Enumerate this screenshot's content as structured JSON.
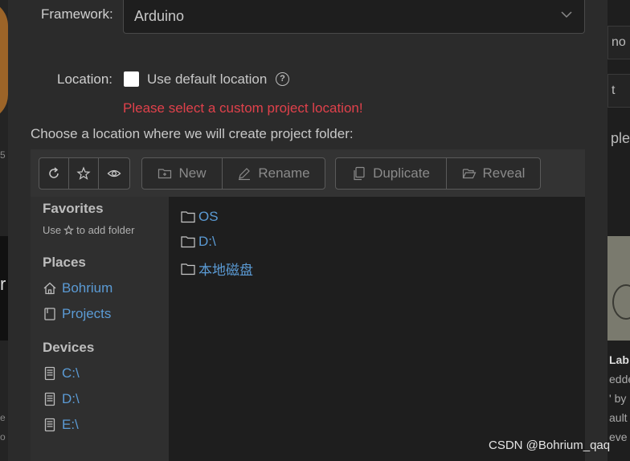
{
  "background": {
    "left_fragments": [
      "5",
      "r",
      "e",
      "o"
    ],
    "right_fragments": {
      "box1": "no",
      "box2": "t",
      "box3": "ple",
      "card_title": "Lab",
      "card_lines": [
        "edde",
        "' by",
        "ault",
        "eve"
      ]
    }
  },
  "dialog": {
    "framework": {
      "label": "Framework:",
      "value": "Arduino"
    },
    "location": {
      "label": "Location:",
      "checkbox_label": "Use default location",
      "help": "?",
      "error": "Please select a custom project location!"
    },
    "choose_text": "Choose a location where we will create project folder:"
  },
  "toolbar": {
    "new_label": "New",
    "rename_label": "Rename",
    "duplicate_label": "Duplicate",
    "reveal_label": "Reveal"
  },
  "sidebar": {
    "favorites_title": "Favorites",
    "favorites_hint_pre": "Use",
    "favorites_hint_post": "to add folder",
    "places_title": "Places",
    "places": [
      "Bohrium",
      "Projects"
    ],
    "devices_title": "Devices",
    "devices": [
      "C:\\",
      "D:\\",
      "E:\\"
    ]
  },
  "folders": [
    "OS",
    "D:\\",
    "本地磁盘"
  ],
  "watermark": "CSDN @Bohrium_qaq",
  "colors": {
    "link": "#5b9bd5",
    "error": "#e0414b",
    "dialog_bg": "#2b2b2b"
  }
}
